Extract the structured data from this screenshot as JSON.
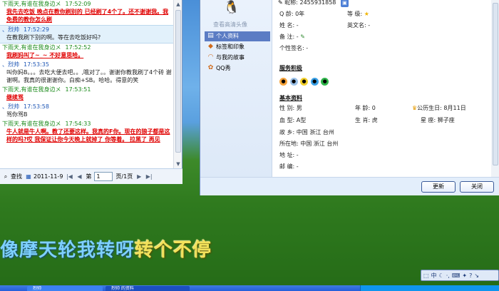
{
  "chat": {
    "messages": [
      {
        "sender": "下雨天,有谁在我身边メ",
        "time": "17:52:09",
        "text": "我先去吃饭 晚点在教你刷别的 已经刷了4个了。还不谢谢我。我免费的教你怎么刷",
        "self": false,
        "red": true,
        "hl": false
      },
      {
        "sender": "、烈帅",
        "time": "17:52:29",
        "text": "在教我刷下别的啊。等在去吃饭好吗?",
        "self": true,
        "red": false,
        "hl": true
      },
      {
        "sender": "下雨天,有谁在我身边メ",
        "time": "17:52:52",
        "text": "我刷妈叫了~_~ 不好意思哈。",
        "self": false,
        "red": true,
        "hl": false
      },
      {
        "sender": "、烈帅",
        "time": "17:53:35",
        "text": "叫你妈B。。。去吃大便去吧。。,哦对了。。谢谢你教我刷了4个砖 谢谢啊。我真的很谢谢你。白痴+SB。哈哈。得意的笑",
        "self": true,
        "red": false,
        "hl": false
      },
      {
        "sender": "下雨天,有谁在我身边メ",
        "time": "17:53:51",
        "text": "继续骂",
        "self": false,
        "red": true,
        "hl": false
      },
      {
        "sender": "、烈帅",
        "time": "17:53:58",
        "text": "骂你骂B",
        "self": true,
        "red": false,
        "hl": false
      },
      {
        "sender": "下雨天,有谁在我身边メ",
        "time": "17:54:33",
        "text": "牛人就是牛人啊。教了还要这样。我真的F你。现在的狼子都是这样的吗?哎 我保证让你今天晚上就掉了 你等着。 拉黑了 再见",
        "self": false,
        "red": true,
        "hl": false
      }
    ],
    "toolbar": {
      "find": "查找",
      "date": "2011-11-9",
      "page_prefix": "第",
      "page_value": "1",
      "page_suffix": "页/1页"
    }
  },
  "profile": {
    "change_avatar": "查看高清头像",
    "nav": [
      {
        "label": "个人资料",
        "icon": "id-card-icon",
        "active": true
      },
      {
        "label": "标签和印象",
        "icon": "tag-icon",
        "active": false
      },
      {
        "label": "与我的故事",
        "icon": "rainbow-icon",
        "active": false
      },
      {
        "label": "QQ秀",
        "icon": "qq-show-icon",
        "active": false
      }
    ],
    "top": {
      "nickname_label": "昵称:",
      "qq_number": "2455931858"
    },
    "basic": {
      "age_label": "Q 龄:",
      "age_value": "0年",
      "level_label": "等 级:",
      "name_label": "姓 名:",
      "name_value": "-",
      "en_name_label": "英文名:",
      "en_name_value": "-",
      "remark_label": "备 注:",
      "remark_value": "-",
      "signature_label": "个性签名:",
      "signature_value": "-"
    },
    "services_title": "服务积极",
    "detail_title": "基本资料",
    "details": {
      "gender_label": "性 别:",
      "gender_value": "男",
      "age2_label": "年 龄:",
      "age2_value": "0",
      "birthday_label": "公历生日:",
      "birthday_value": "8月11日",
      "blood_label": "血 型:",
      "blood_value": "A型",
      "zodiac_label": "生 肖:",
      "zodiac_value": "虎",
      "star_label": "星 座:",
      "star_value": "狮子座",
      "hometown_label": "故 乡:",
      "hometown_value": "中国 浙江 台州",
      "location_label": "所在地:",
      "location_value": "中国 浙江 台州",
      "address_label": "地 址:",
      "address_value": "-",
      "zip_label": "邮 编:",
      "zip_value": "-"
    },
    "buttons": {
      "refresh": "更新",
      "close": "关闭"
    }
  },
  "desktop": {
    "lyrics_sung": "像摩天轮我转呀",
    "lyrics_rest": "转个不停",
    "ime": "中",
    "taskbar": {
      "item1": "烈帅",
      "item2": "烈帅 的资料"
    }
  }
}
